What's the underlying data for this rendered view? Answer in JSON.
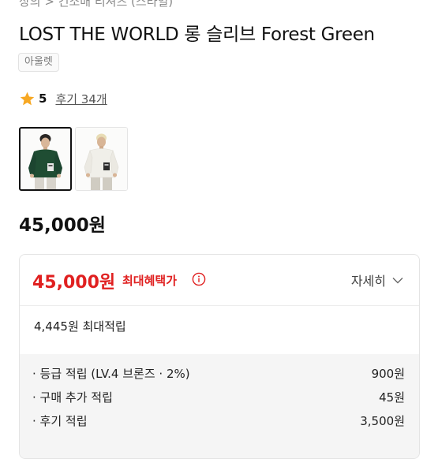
{
  "breadcrumb": "상의 > 긴소매 티셔츠 (스타일)",
  "product": {
    "title": "LOST THE WORLD 롱 슬리브 Forest Green",
    "tag": "아울렛",
    "rating_score": "5",
    "reviews_label": "후기 34개",
    "price": "45,000원"
  },
  "thumbnails": [
    {
      "label": "Forest Green",
      "color": "#1f4d33"
    },
    {
      "label": "White",
      "color": "#f2f1ec"
    }
  ],
  "benefit": {
    "price": "45,000원",
    "max_label": "최대혜택가",
    "detail_label": "자세히",
    "points_total": "4,445원 최대적립",
    "rows": [
      {
        "label": "· 등급 적립 (LV.4 브론즈 · 2%)",
        "value": "900원"
      },
      {
        "label": "· 구매 추가 적립",
        "value": "45원"
      },
      {
        "label": "· 후기 적립",
        "value": "3,500원"
      }
    ]
  },
  "colors": {
    "accent_red": "#e02020",
    "star": "#f7a823"
  }
}
